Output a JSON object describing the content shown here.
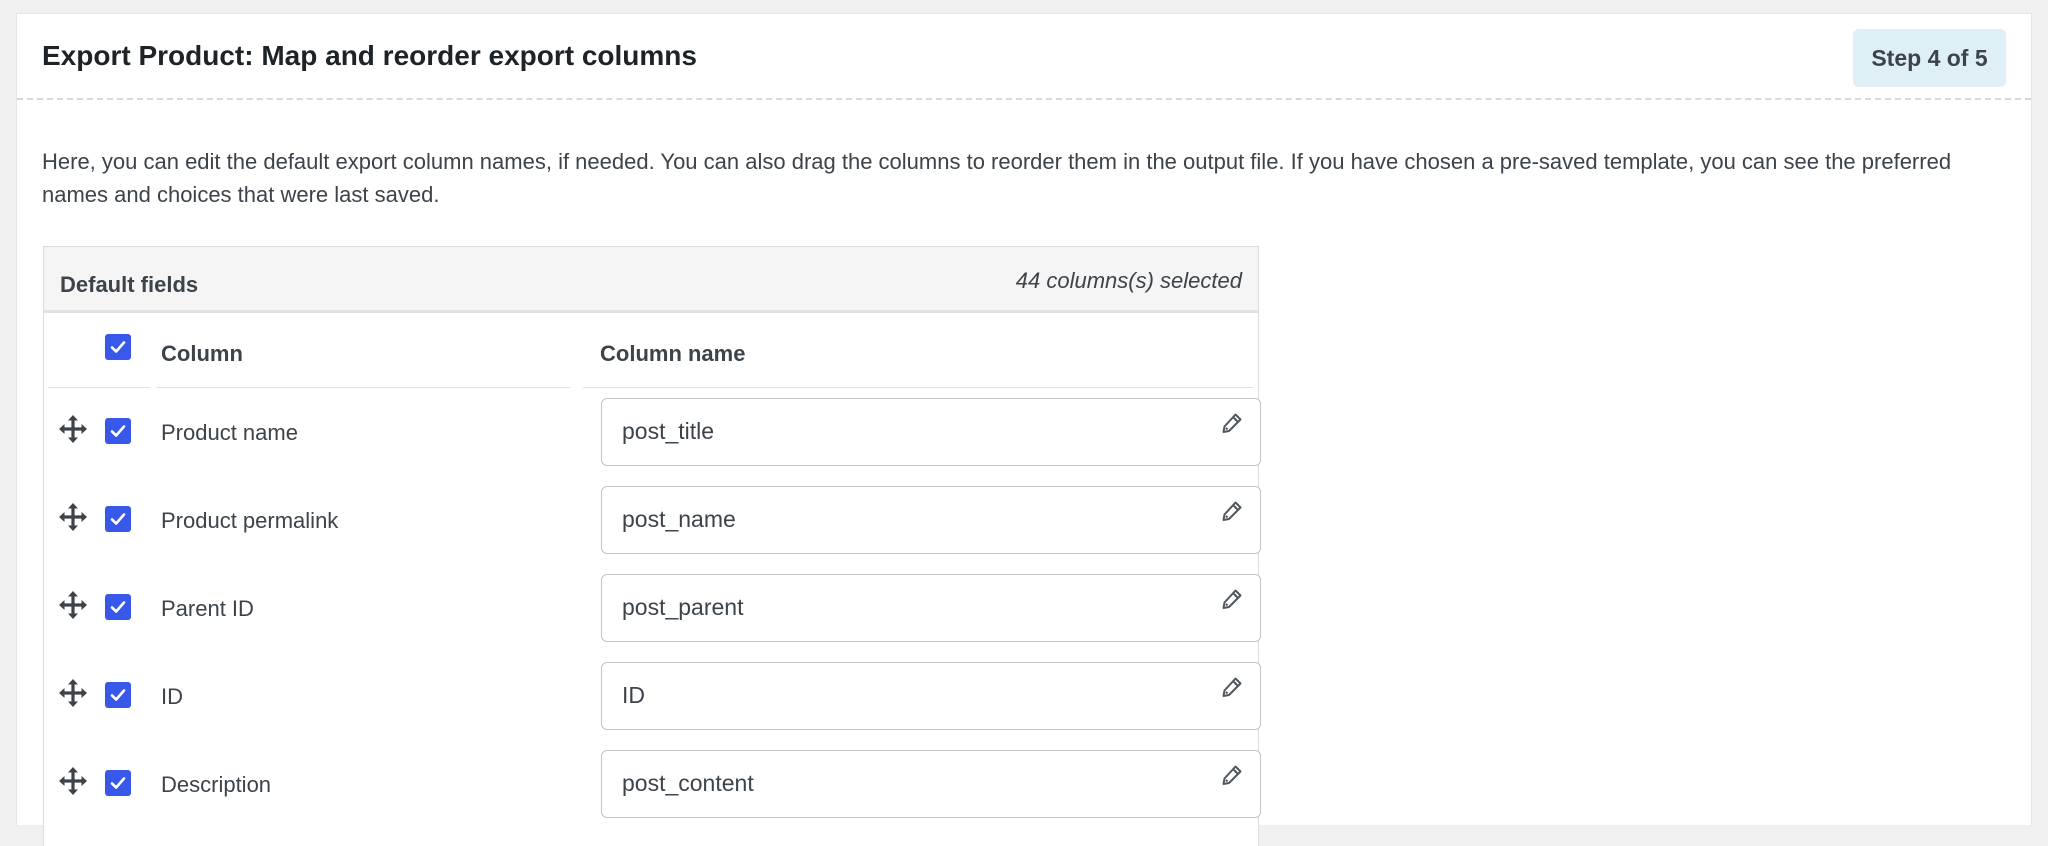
{
  "header": {
    "title": "Export Product: Map and reorder export columns",
    "step_badge": "Step 4 of 5"
  },
  "description": "Here, you can edit the default export column names, if needed. You can also drag the columns to reorder them in the output file. If you have chosen a pre-saved template, you can see the preferred names and choices that were last saved.",
  "fields_panel": {
    "title": "Default fields",
    "selected_count": "44 columns(s) selected",
    "columns": {
      "column": "Column",
      "column_name": "Column name"
    },
    "select_all_checked": true,
    "rows": [
      {
        "label": "Product name",
        "value": "post_title",
        "checked": true
      },
      {
        "label": "Product permalink",
        "value": "post_name",
        "checked": true
      },
      {
        "label": "Parent ID",
        "value": "post_parent",
        "checked": true
      },
      {
        "label": "ID",
        "value": "ID",
        "checked": true
      },
      {
        "label": "Description",
        "value": "post_content",
        "checked": true
      }
    ]
  },
  "colors": {
    "checkbox": "#3858e9",
    "badge_bg": "#def0f6",
    "panel_head_bg": "#f5f5f5"
  },
  "icons": {
    "drag": "move-arrows-icon",
    "edit": "pencil-icon",
    "check": "checkmark-icon"
  }
}
